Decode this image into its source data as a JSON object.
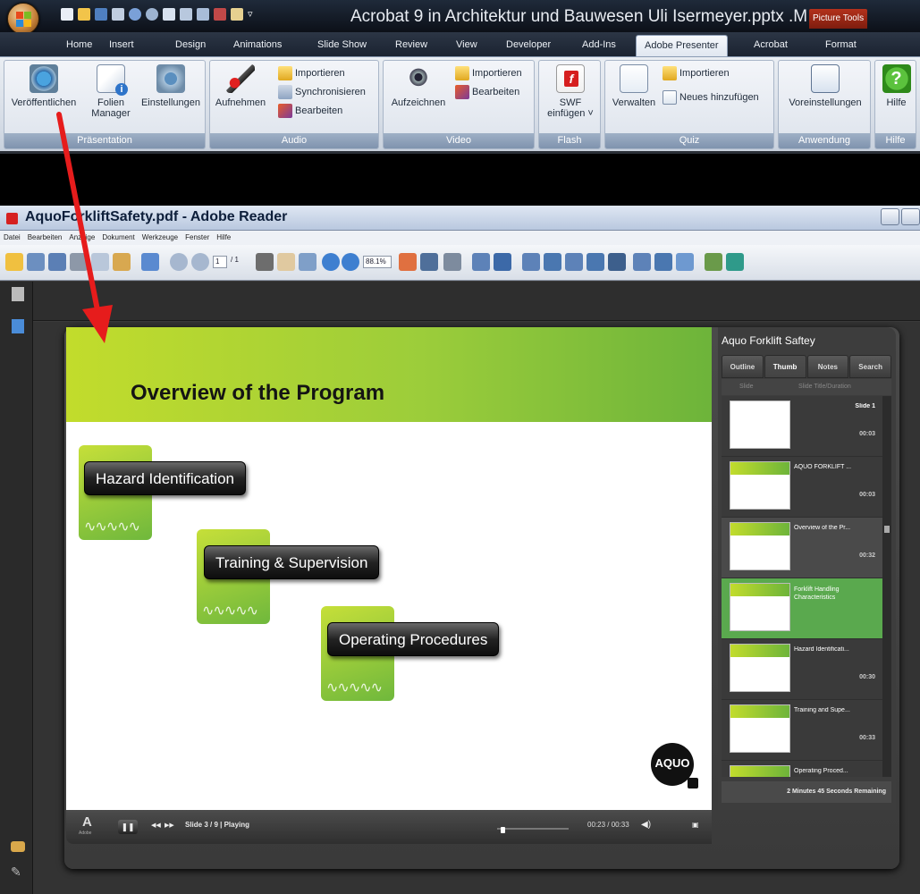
{
  "powerpoint": {
    "title": "Acrobat 9 in Architektur und Bauwesen Uli Isermeyer.pptx .M",
    "context_tab": "Picture Tools",
    "tabs": [
      "Home",
      "Insert",
      "Design",
      "Animations",
      "Slide Show",
      "Review",
      "View",
      "Developer",
      "Add-Ins",
      "Adobe Presenter",
      "Acrobat",
      "Format"
    ],
    "active_tab": "Adobe Presenter",
    "groups": {
      "praesentation": {
        "label": "Präsentation",
        "publish": "Veröffentlichen",
        "slide_manager_line1": "Folien",
        "slide_manager_line2": "Manager",
        "settings": "Einstellungen"
      },
      "audio": {
        "label": "Audio",
        "record": "Aufnehmen",
        "import": "Importieren",
        "sync": "Synchronisieren",
        "edit": "Bearbeiten"
      },
      "video": {
        "label": "Video",
        "capture": "Aufzeichnen",
        "import": "Importieren",
        "edit": "Bearbeiten"
      },
      "flash": {
        "label": "Flash",
        "swf_line1": "SWF",
        "swf_line2": "einfügen ˅"
      },
      "quiz": {
        "label": "Quiz",
        "manage": "Verwalten",
        "import": "Importieren",
        "add_new": "Neues hinzufügen"
      },
      "anwendung": {
        "label": "Anwendung",
        "prefs": "Voreinstellungen"
      },
      "hilfe": {
        "label": "Hilfe",
        "help": "Hilfe"
      }
    }
  },
  "reader": {
    "title": "AquoForkliftSafety.pdf - Adobe Reader",
    "menu": [
      "Datei",
      "Bearbeiten",
      "Anzeige",
      "Dokument",
      "Werkzeuge",
      "Fenster",
      "Hilfe"
    ],
    "page_field": "1",
    "page_total": "/ 1",
    "zoom": "88.1%"
  },
  "presentation": {
    "slide_title": "Overview of the Program",
    "items": [
      "Hazard Identification",
      "Training & Supervision",
      "Operating Procedures"
    ],
    "logo_text": "AQUO",
    "playbar": {
      "adobe_mark": "A",
      "adobe_sub": "Adobe",
      "status": "Slide 3 / 9 | Playing",
      "time": "00:23 / 00:33",
      "progress": 0.05
    },
    "panel": {
      "title": "Aquo Forklift Saftey",
      "tabs": [
        "Outline",
        "Thumb",
        "Notes",
        "Search"
      ],
      "active_tab": "Thumb",
      "col_slide": "Slide",
      "col_title": "Slide Title/Duration",
      "rows": [
        {
          "title": "Slide 1",
          "time": "00:03"
        },
        {
          "title": "AQUO FORKLIFT ...",
          "time": "00:03"
        },
        {
          "title": "Overview of the Pr...",
          "time": "00:32"
        },
        {
          "title": "Forklift Handling Characteristics",
          "time": ""
        },
        {
          "title": "Hazard Identificati...",
          "time": "00:30"
        },
        {
          "title": "Training and Supe...",
          "time": "00:33"
        },
        {
          "title": "Operating Proced...",
          "time": ""
        }
      ],
      "footer": "2 Minutes 45 Seconds Remaining"
    }
  },
  "colors": {
    "arrow": "#e61c1c",
    "green_band": "#9ccd3a",
    "highlight_row": "#5aa94e"
  }
}
